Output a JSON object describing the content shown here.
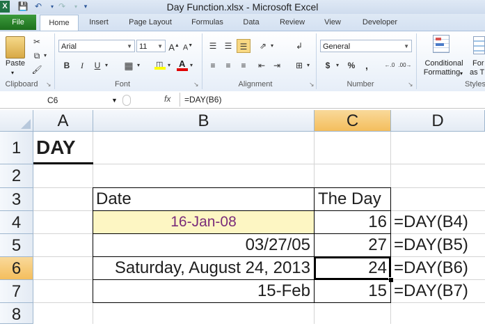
{
  "window": {
    "title": "Day Function.xlsx  -  Microsoft Excel"
  },
  "ribbon": {
    "file_tab": "File",
    "tabs": [
      "Home",
      "Insert",
      "Page Layout",
      "Formulas",
      "Data",
      "Review",
      "View",
      "Developer"
    ],
    "clipboard": {
      "label": "Clipboard",
      "paste": "Paste"
    },
    "font": {
      "label": "Font",
      "name": "Arial",
      "size": "11"
    },
    "alignment": {
      "label": "Alignment"
    },
    "number": {
      "label": "Number",
      "format": "General"
    },
    "styles": {
      "label": "Styles",
      "conditional_line1": "Conditional",
      "conditional_line2": "Formatting",
      "format_as_table_line1": "For",
      "format_as_table_line2": "as T"
    }
  },
  "formula_bar": {
    "name_box": "C6",
    "fx": "fx",
    "formula": "=DAY(B6)"
  },
  "sheet": {
    "columns": [
      "A",
      "B",
      "C",
      "D"
    ],
    "rows": [
      "1",
      "2",
      "3",
      "4",
      "5",
      "6",
      "7",
      "8"
    ],
    "a1": "DAY",
    "header": {
      "date": "Date",
      "day": "The Day"
    },
    "rows_data": [
      {
        "date": "16-Jan-08",
        "day": "16",
        "formula": "=DAY(B4)"
      },
      {
        "date": "03/27/05",
        "day": "27",
        "formula": "=DAY(B5)"
      },
      {
        "date": "Saturday, August 24, 2013",
        "day": "24",
        "formula": "=DAY(B6)"
      },
      {
        "date": "15-Feb",
        "day": "15",
        "formula": "=DAY(B7)"
      }
    ],
    "colors": {
      "highlight_fill": "#fdf6c3",
      "highlight_text": "#7a2c7a",
      "selection": "#f4be5d"
    }
  }
}
